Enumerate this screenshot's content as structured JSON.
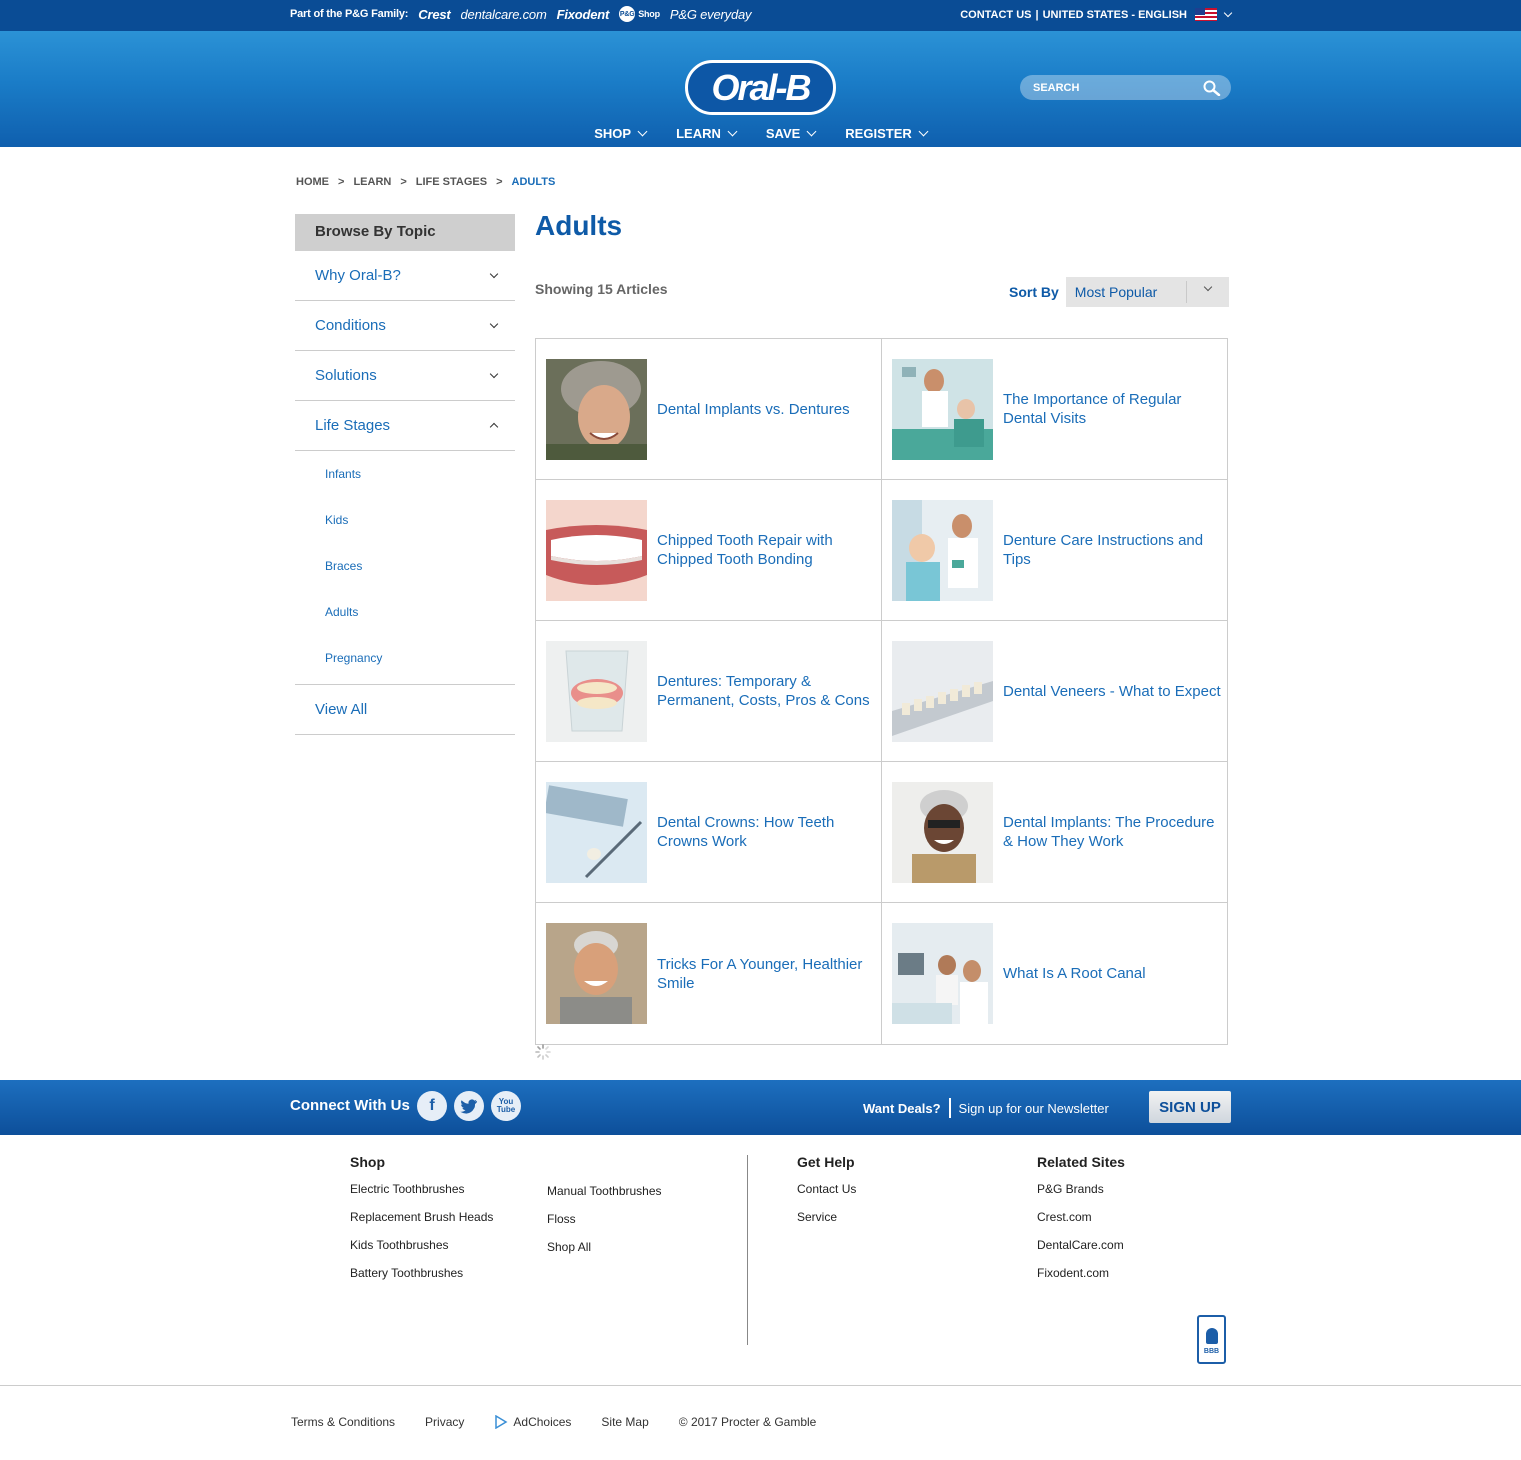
{
  "top_bar": {
    "family_label": "Part of the P&G Family:",
    "brands": [
      "Crest",
      "dentalcare.com",
      "Fixodent",
      "Shop",
      "P&G everyday"
    ],
    "contact": "CONTACT US",
    "region": "UNITED STATES - ENGLISH"
  },
  "header": {
    "logo": "Oral-B",
    "search_placeholder": "SEARCH",
    "nav": [
      "SHOP",
      "LEARN",
      "SAVE",
      "REGISTER"
    ]
  },
  "breadcrumb": [
    "HOME",
    "LEARN",
    "LIFE STAGES",
    "ADULTS"
  ],
  "sidebar": {
    "heading": "Browse By Topic",
    "items": [
      {
        "label": "Why Oral-B?",
        "expanded": false
      },
      {
        "label": "Conditions",
        "expanded": false
      },
      {
        "label": "Solutions",
        "expanded": false
      },
      {
        "label": "Life Stages",
        "expanded": true
      }
    ],
    "sub_items": [
      "Infants",
      "Kids",
      "Braces",
      "Adults",
      "Pregnancy"
    ],
    "view_all": "View All"
  },
  "main": {
    "title": "Adults",
    "showing": "Showing 15 Articles",
    "sort_label": "Sort By",
    "sort_value": "Most Popular",
    "articles": [
      {
        "title": "Dental Implants vs. Dentures",
        "img": "smiling-woman-gray-hair"
      },
      {
        "title": "The Importance of Regular Dental Visits",
        "img": "dentist-with-patient"
      },
      {
        "title": "Chipped Tooth Repair with Chipped Tooth Bonding",
        "img": "teeth-closeup"
      },
      {
        "title": "Denture Care Instructions and Tips",
        "img": "dentist-with-elderly-patient"
      },
      {
        "title": "Dentures: Temporary & Permanent, Costs, Pros & Cons",
        "img": "dentures-in-glass"
      },
      {
        "title": "Dental Veneers - What to Expect",
        "img": "veneer-shade-guide"
      },
      {
        "title": "Dental Crowns: How Teeth Crowns Work",
        "img": "crown-on-tweezers"
      },
      {
        "title": "Dental Implants: The Procedure & How They Work",
        "img": "smiling-woman-glasses"
      },
      {
        "title": "Tricks For A Younger, Healthier Smile",
        "img": "smiling-older-man"
      },
      {
        "title": "What Is A Root Canal",
        "img": "dentist-showing-xray"
      }
    ]
  },
  "connect": {
    "heading": "Connect With Us",
    "social": [
      "facebook",
      "twitter",
      "youtube"
    ],
    "deals": "Want Deals?",
    "newsletter": "Sign up for our Newsletter",
    "signup": "SIGN UP"
  },
  "footer": {
    "shop_heading": "Shop",
    "shop_col1": [
      "Electric Toothbrushes",
      "Replacement Brush Heads",
      "Kids Toothbrushes",
      "Battery Toothbrushes"
    ],
    "shop_col2": [
      "Manual Toothbrushes",
      "Floss",
      "Shop All"
    ],
    "help_heading": "Get Help",
    "help": [
      "Contact Us",
      "Service"
    ],
    "related_heading": "Related Sites",
    "related": [
      "P&G Brands",
      "Crest.com",
      "DentalCare.com",
      "Fixodent.com"
    ],
    "bbb": "BBB",
    "legal": [
      "Terms & Conditions",
      "Privacy",
      "AdChoices",
      "Site Map",
      "© 2017 Procter & Gamble"
    ]
  },
  "colors": {
    "brand_blue": "#0e5aa7",
    "link_blue": "#1a6db8",
    "top_bar": "#0a4c95"
  }
}
